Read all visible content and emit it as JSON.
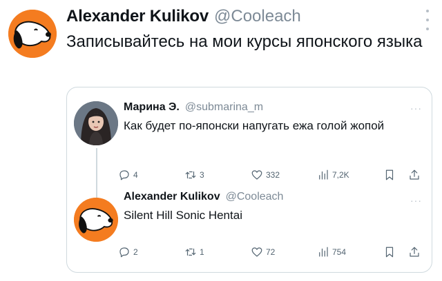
{
  "tweet": {
    "author_name": "Alexander Kulikov",
    "author_handle": "@Cooleach",
    "text": "Записывайтесь на мои курсы японского языка"
  },
  "quoted_thread": [
    {
      "author_name": "Марина Э.",
      "author_handle": "@submarina_m",
      "text": "Как будет по-японски напугать ежа голой жопой",
      "more": "···",
      "stats": {
        "replies": "4",
        "retweets": "3",
        "likes": "332",
        "views": "7,2K"
      }
    },
    {
      "author_name": "Alexander Kulikov",
      "author_handle": "@Cooleach",
      "text": "Silent Hill Sonic Hentai",
      "more": "···",
      "stats": {
        "replies": "2",
        "retweets": "1",
        "likes": "72",
        "views": "754"
      }
    }
  ],
  "icons": {
    "avatar_main": "snoopy-avatar",
    "avatar_reply_1": "girl-avatar",
    "avatar_reply_2": "snoopy-avatar",
    "actions": [
      "reply-icon",
      "retweet-icon",
      "like-icon",
      "views-icon",
      "bookmark-icon",
      "share-icon"
    ]
  },
  "colors": {
    "avatar_orange": "#f47c20",
    "text_primary": "#0f1419",
    "text_secondary": "#7d8a96",
    "border": "#cfd9de"
  }
}
